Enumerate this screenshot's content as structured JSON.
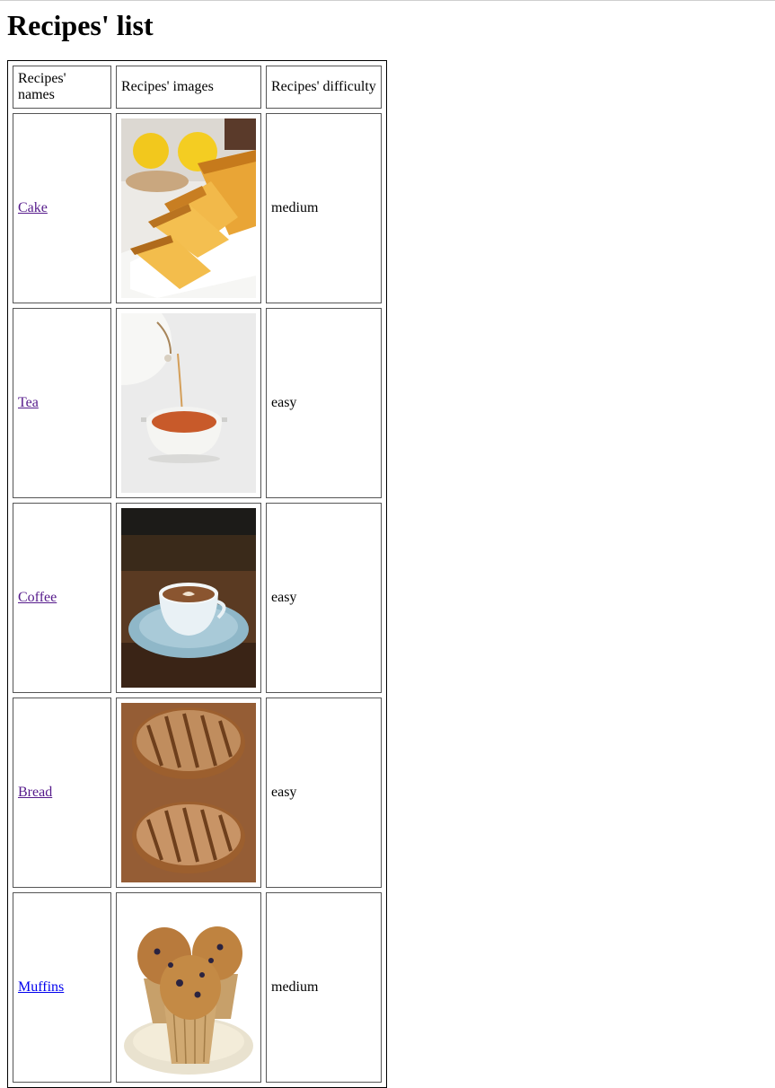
{
  "page": {
    "title": "Recipes' list"
  },
  "table": {
    "headers": {
      "names": "Recipes' names",
      "images": "Recipes' images",
      "difficulty": "Recipes' difficulty"
    },
    "rows": [
      {
        "name": "Cake",
        "difficulty": "medium",
        "image": "lemon-pound-cake-photo",
        "visited": true
      },
      {
        "name": "Tea",
        "difficulty": "easy",
        "image": "tea-pouring-photo",
        "visited": true
      },
      {
        "name": "Coffee",
        "difficulty": "easy",
        "image": "coffee-cup-photo",
        "visited": true
      },
      {
        "name": "Bread",
        "difficulty": "easy",
        "image": "bread-loaves-photo",
        "visited": true
      },
      {
        "name": "Muffins",
        "difficulty": "medium",
        "image": "blueberry-muffins-photo",
        "visited": false
      }
    ]
  },
  "colors": {
    "visited_link": "#551a8b",
    "unvisited_link": "#0000ee"
  }
}
